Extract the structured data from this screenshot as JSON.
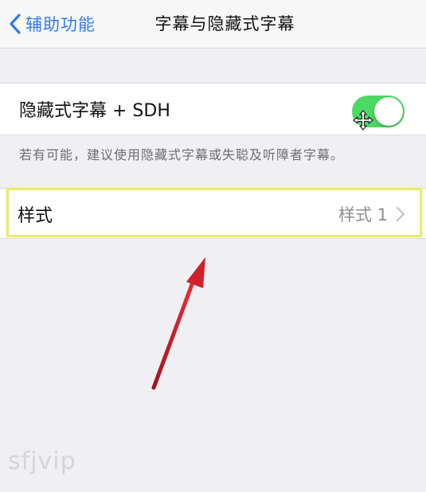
{
  "nav": {
    "back_label": "辅助功能",
    "title": "字幕与隐藏式字幕"
  },
  "settings": {
    "cc_sdh": {
      "label": "隐藏式字幕 + SDH",
      "enabled": true,
      "footnote": "若有可能，建议使用隐藏式字幕或失聪及听障者字幕。"
    },
    "style": {
      "label": "样式",
      "value": "样式 1"
    }
  },
  "colors": {
    "accent": "#2f7bf6",
    "toggle_on": "#4cd964",
    "highlight": "#e8eb6f",
    "arrow": "#d2202a"
  },
  "watermark": "sfjvip",
  "icons": [
    "chevron-left-icon",
    "chevron-right-icon",
    "move-cursor-icon"
  ]
}
